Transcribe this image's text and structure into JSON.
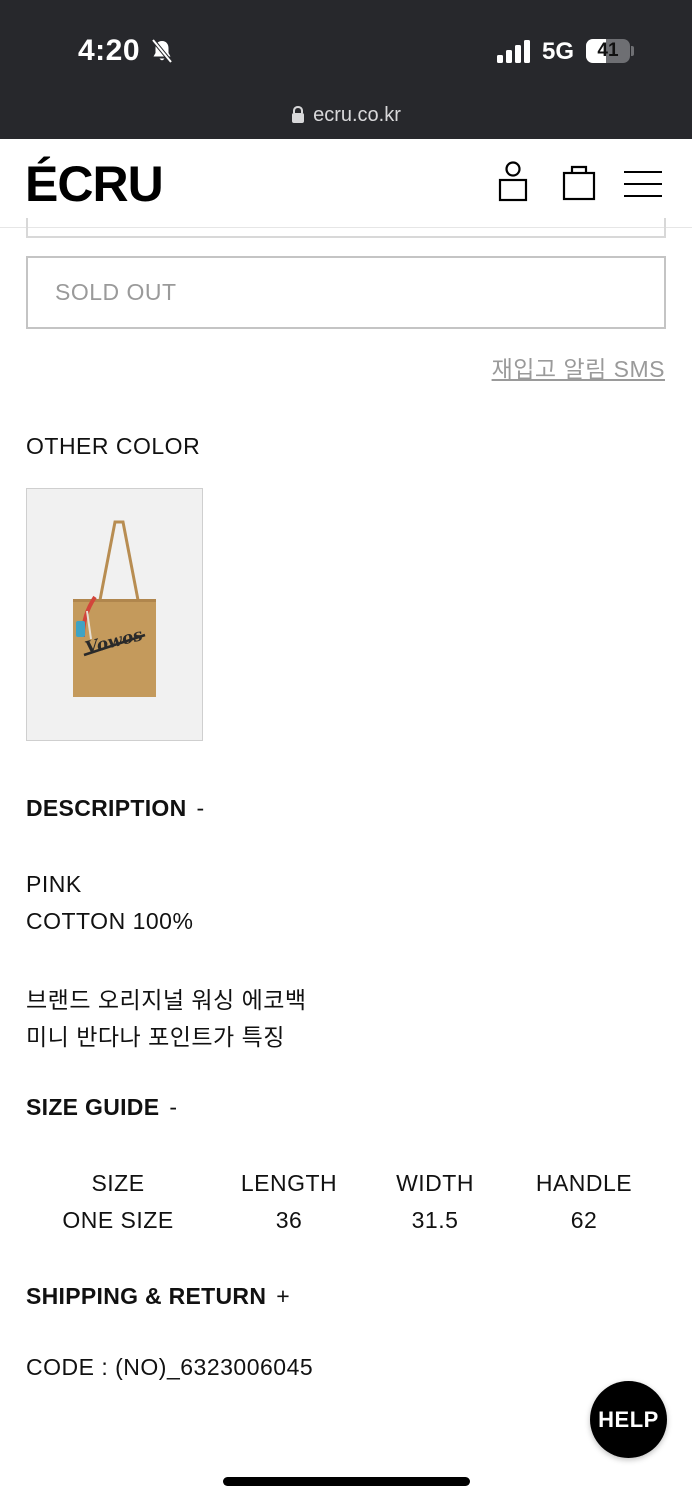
{
  "status_bar": {
    "time": "4:20",
    "network": "5G",
    "battery": "41",
    "url": "ecru.co.kr",
    "icons": [
      "bell-off-icon",
      "signal-icon",
      "lock-icon"
    ]
  },
  "header": {
    "logo": "ÉCRU",
    "icons": [
      "user-icon",
      "bag-icon",
      "menu-icon"
    ]
  },
  "purchase": {
    "sold_out_label": "SOLD OUT",
    "restock_link": "재입고 알림 SMS"
  },
  "other_color": {
    "title": "OTHER COLOR",
    "thumbnail_text": "Vowos"
  },
  "description": {
    "title": "DESCRIPTION",
    "toggle": "-",
    "lines": [
      "PINK",
      "COTTON 100%",
      "브랜드 오리지널 워싱 에코백",
      "미니 반다나 포인트가 특징"
    ]
  },
  "size_guide": {
    "title": "SIZE GUIDE",
    "toggle": "-",
    "headers": [
      "SIZE",
      "LENGTH",
      "WIDTH",
      "HANDLE"
    ],
    "rows": [
      [
        "ONE SIZE",
        "36",
        "31.5",
        "62"
      ]
    ]
  },
  "shipping": {
    "title": "SHIPPING & RETURN",
    "toggle": "+"
  },
  "code": "CODE : (NO)_6323006045",
  "help_button": "HELP",
  "colors": {
    "status_bar_bg": "#27282c",
    "accent": "#000000",
    "muted_text": "#9a9a9a",
    "tote_color": "#c49a5c"
  }
}
